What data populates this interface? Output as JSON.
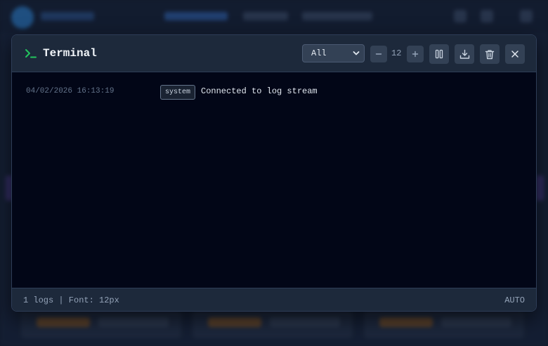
{
  "terminal": {
    "title": "Terminal",
    "icon": "terminal-prompt-icon",
    "accent_color": "#22c55e",
    "filter": {
      "selected": "All"
    },
    "font_size": "12",
    "toolbar_icons": [
      "minus-icon",
      "plus-icon",
      "pause-icon",
      "download-icon",
      "trash-icon",
      "close-icon"
    ]
  },
  "logs": [
    {
      "timestamp": "04/02/2026 16:13:19",
      "source": "system",
      "message": "Connected to log stream"
    }
  ],
  "footer": {
    "stats": "1 logs | Font: 12px",
    "autoscroll": "AUTO"
  }
}
